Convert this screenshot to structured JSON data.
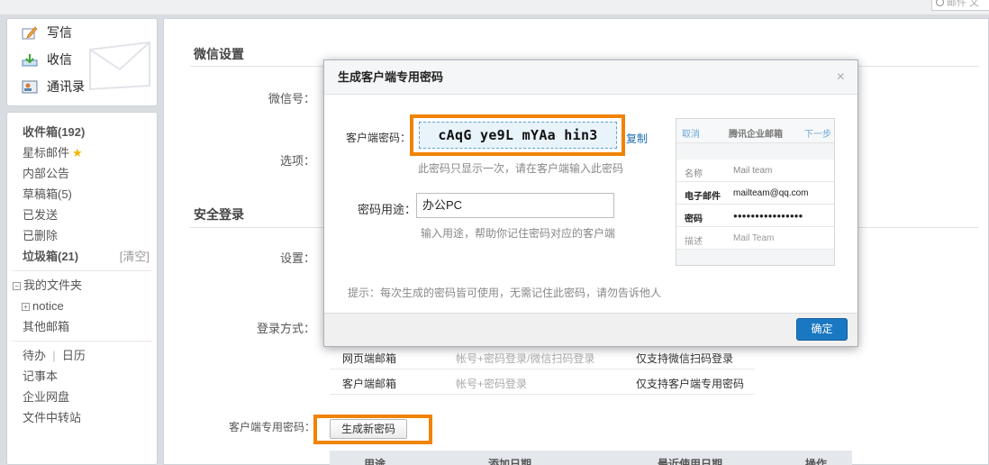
{
  "search": {
    "placeholder": "邮件 文"
  },
  "sidebar": {
    "top": [
      {
        "label": "写信",
        "icon": "compose-icon"
      },
      {
        "label": "收信",
        "icon": "inbox-download-icon"
      },
      {
        "label": "通讯录",
        "icon": "contacts-icon"
      }
    ],
    "inbox": "收件箱(192)",
    "starred": "星标邮件",
    "internal": "内部公告",
    "drafts": "草稿箱(5)",
    "sent": "已发送",
    "deleted": "已删除",
    "spam": "垃圾箱(21)",
    "clear": "[清空]",
    "my_folders": "我的文件夹",
    "notice": "notice",
    "other_mail": "其他邮箱",
    "todo": "待办",
    "sep": "|",
    "calendar": "日历",
    "notebook": "记事本",
    "netdisk": "企业网盘",
    "transfer": "文件中转站"
  },
  "main": {
    "wechat_title": "微信设置",
    "wechat_no_label": "微信号：",
    "options_label": "选项：",
    "security_title": "安全登录",
    "settings_label": "设置：",
    "login_method_label": "登录方式：",
    "rows": [
      {
        "name": "网页端邮箱",
        "method": "帐号+密码登录/微信扫码登录",
        "note": "仅支持微信扫码登录"
      },
      {
        "name": "客户端邮箱",
        "method": "帐号+密码登录",
        "note": "仅支持客户端专用密码"
      }
    ],
    "client_pw_label": "客户端专用密码：",
    "generate_button": "生成新密码",
    "table_headers": [
      "用途",
      "添加日期",
      "最近使用日期",
      "操作"
    ]
  },
  "dialog": {
    "title": "生成客户端专用密码",
    "close": "×",
    "client_pw_label": "客户端密码：",
    "password": "cAqG ye9L mYAa hin3",
    "copy": "复制",
    "pw_hint": "此密码只显示一次，请在客户端输入此密码",
    "usage_label": "密码用途：",
    "usage_value": "办公PC",
    "usage_hint": "输入用途，帮助你记住密码对应的客户端",
    "tip": "提示：每次生成的密码皆可使用，无需记住此密码，请勿告诉他人",
    "ok": "确定",
    "phone": {
      "cancel": "取消",
      "title": "腾讯企业邮箱",
      "next": "下一步",
      "rows": [
        {
          "k": "名称",
          "v": "Mail team"
        },
        {
          "k": "电子邮件",
          "v": "mailteam@qq.com"
        },
        {
          "k": "密码",
          "v": "●●●●●●●●●●●●●●●●"
        },
        {
          "k": "描述",
          "v": "Mail Team"
        }
      ]
    }
  },
  "colors": {
    "highlight": "#f08300",
    "primary": "#1a78c2",
    "link": "#1a6db3"
  }
}
